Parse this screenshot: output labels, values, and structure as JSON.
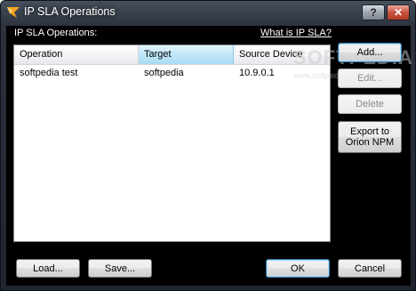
{
  "window": {
    "title": "IP SLA Operations",
    "help_label": "?",
    "close_label": "✕"
  },
  "section_label": "IP SLA Operations:",
  "help_link": "What is IP SLA?",
  "table": {
    "columns": [
      "Operation",
      "Target",
      "Source Device"
    ],
    "sorted_column": "Target",
    "rows": [
      [
        "softpedia test",
        "softpedia",
        "10.9.0.1"
      ]
    ]
  },
  "side_buttons": {
    "add": "Add...",
    "edit": "Edit...",
    "delete": "Delete",
    "export_line1": "Export to",
    "export_line2": "Orion NPM"
  },
  "bottom_buttons": {
    "load": "Load...",
    "save": "Save...",
    "ok": "OK",
    "cancel": "Cancel"
  },
  "watermark": {
    "text": "SOFTPEDIA",
    "sub": "www.softpedia.com"
  },
  "colors": {
    "accent": "#3c7fb1",
    "background": "#000000"
  }
}
